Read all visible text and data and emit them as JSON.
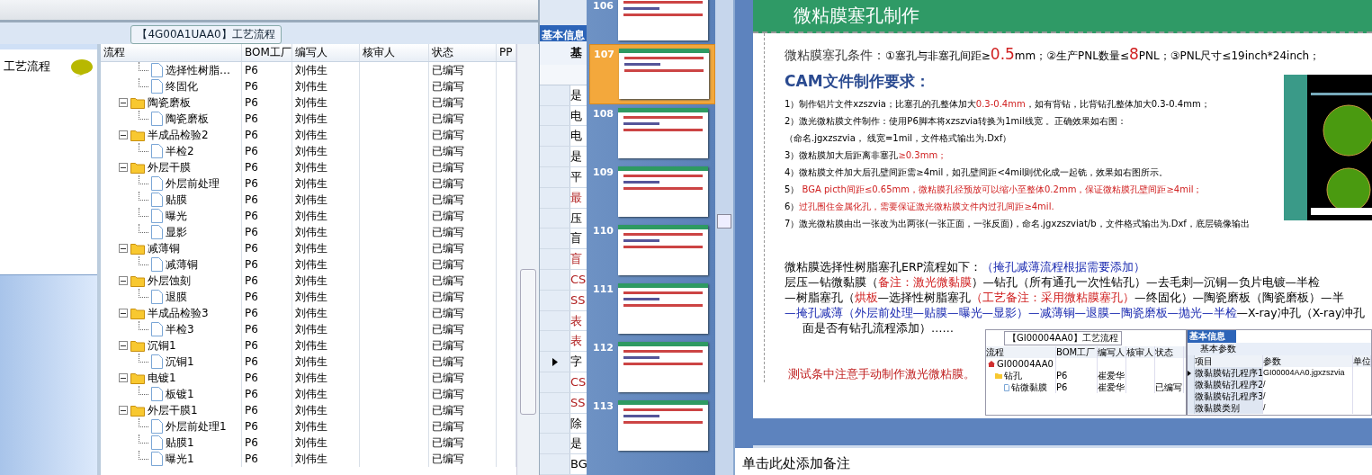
{
  "erp": {
    "title": "【4G00A1UAA0】工艺流程",
    "side_label": "工艺流程",
    "columns": [
      "流程",
      "BOM工厂",
      "编写人",
      "核审人",
      "状态",
      "PP"
    ],
    "tree": [
      {
        "kind": "continued",
        "children": [
          {
            "kind": "doc",
            "label": "选择性树脂…",
            "bom": "P6",
            "writer": "刘伟生",
            "status": "已编写"
          },
          {
            "kind": "doc",
            "label": "终固化",
            "bom": "P6",
            "writer": "刘伟生",
            "status": "已编写"
          }
        ]
      },
      {
        "kind": "folder",
        "label": "陶瓷磨板",
        "bom": "P6",
        "writer": "刘伟生",
        "status": "已编写",
        "expanded": true,
        "children": [
          {
            "kind": "doc",
            "label": "陶瓷磨板",
            "bom": "P6",
            "writer": "刘伟生",
            "status": "已编写"
          }
        ]
      },
      {
        "kind": "folder",
        "label": "半成品检验2",
        "bom": "P6",
        "writer": "刘伟生",
        "status": "已编写",
        "expanded": true,
        "children": [
          {
            "kind": "doc",
            "label": "半检2",
            "bom": "P6",
            "writer": "刘伟生",
            "status": "已编写"
          }
        ]
      },
      {
        "kind": "folder",
        "label": "外层干膜",
        "bom": "P6",
        "writer": "刘伟生",
        "status": "已编写",
        "expanded": true,
        "children": [
          {
            "kind": "doc",
            "label": "外层前处理",
            "bom": "P6",
            "writer": "刘伟生",
            "status": "已编写"
          },
          {
            "kind": "doc",
            "label": "贴膜",
            "bom": "P6",
            "writer": "刘伟生",
            "status": "已编写"
          },
          {
            "kind": "doc",
            "label": "曝光",
            "bom": "P6",
            "writer": "刘伟生",
            "status": "已编写"
          },
          {
            "kind": "doc",
            "label": "显影",
            "bom": "P6",
            "writer": "刘伟生",
            "status": "已编写"
          }
        ]
      },
      {
        "kind": "folder",
        "label": "减薄铜",
        "bom": "P6",
        "writer": "刘伟生",
        "status": "已编写",
        "expanded": true,
        "children": [
          {
            "kind": "doc",
            "label": "减薄铜",
            "bom": "P6",
            "writer": "刘伟生",
            "status": "已编写"
          }
        ]
      },
      {
        "kind": "folder",
        "label": "外层蚀刻",
        "bom": "P6",
        "writer": "刘伟生",
        "status": "已编写",
        "expanded": true,
        "children": [
          {
            "kind": "doc",
            "label": "退膜",
            "bom": "P6",
            "writer": "刘伟生",
            "status": "已编写"
          }
        ]
      },
      {
        "kind": "folder",
        "label": "半成品检验3",
        "bom": "P6",
        "writer": "刘伟生",
        "status": "已编写",
        "expanded": true,
        "children": [
          {
            "kind": "doc",
            "label": "半检3",
            "bom": "P6",
            "writer": "刘伟生",
            "status": "已编写"
          }
        ]
      },
      {
        "kind": "folder",
        "label": "沉铜1",
        "bom": "P6",
        "writer": "刘伟生",
        "status": "已编写",
        "expanded": true,
        "children": [
          {
            "kind": "doc",
            "label": "沉铜1",
            "bom": "P6",
            "writer": "刘伟生",
            "status": "已编写"
          }
        ]
      },
      {
        "kind": "folder",
        "label": "电镀1",
        "bom": "P6",
        "writer": "刘伟生",
        "status": "已编写",
        "expanded": true,
        "children": [
          {
            "kind": "doc",
            "label": "板镀1",
            "bom": "P6",
            "writer": "刘伟生",
            "status": "已编写"
          }
        ]
      },
      {
        "kind": "folder",
        "label": "外层干膜1",
        "bom": "P6",
        "writer": "刘伟生",
        "status": "已编写",
        "expanded": true,
        "children": [
          {
            "kind": "doc",
            "label": "外层前处理1",
            "bom": "P6",
            "writer": "刘伟生",
            "status": "已编写"
          },
          {
            "kind": "doc",
            "label": "贴膜1",
            "bom": "P6",
            "writer": "刘伟生",
            "status": "已编写"
          },
          {
            "kind": "doc",
            "label": "曝光1",
            "bom": "P6",
            "writer": "刘伟生",
            "status": "已编写"
          }
        ]
      }
    ]
  },
  "info": {
    "tab": "基本信息",
    "subtab": "基",
    "rows": [
      {
        "text": "是",
        "alert": false,
        "current": false
      },
      {
        "text": "电",
        "alert": false,
        "current": false
      },
      {
        "text": "电",
        "alert": false,
        "current": false
      },
      {
        "text": "是",
        "alert": false,
        "current": false
      },
      {
        "text": "平",
        "alert": false,
        "current": false
      },
      {
        "text": "最",
        "alert": true,
        "current": false
      },
      {
        "text": "压",
        "alert": false,
        "current": false
      },
      {
        "text": "盲",
        "alert": false,
        "current": false
      },
      {
        "text": "盲",
        "alert": true,
        "current": false
      },
      {
        "text": "CS",
        "alert": true,
        "current": false
      },
      {
        "text": "SS",
        "alert": true,
        "current": false
      },
      {
        "text": "表",
        "alert": true,
        "current": false
      },
      {
        "text": "表",
        "alert": true,
        "current": false
      },
      {
        "text": "字",
        "alert": false,
        "current": true
      },
      {
        "text": "CS",
        "alert": true,
        "current": false
      },
      {
        "text": "SS",
        "alert": true,
        "current": false
      },
      {
        "text": "除",
        "alert": false,
        "current": false
      },
      {
        "text": "是",
        "alert": false,
        "current": false
      },
      {
        "text": "BG",
        "alert": false,
        "current": false
      }
    ]
  },
  "slides": [
    {
      "number": "106",
      "selected": false
    },
    {
      "number": "107",
      "selected": true
    },
    {
      "number": "108",
      "selected": false
    },
    {
      "number": "109",
      "selected": false
    },
    {
      "number": "110",
      "selected": false
    },
    {
      "number": "111",
      "selected": false
    },
    {
      "number": "112",
      "selected": false
    },
    {
      "number": "113",
      "selected": false
    }
  ],
  "slide": {
    "title": "微粘膜塞孔制作",
    "conditions": [
      {
        "text": "微粘膜塞孔条件：",
        "kind": "lead"
      },
      {
        "text": "①塞孔与非塞孔间距≥",
        "kind": "plain"
      },
      {
        "text": "0.5",
        "kind": "alert"
      },
      {
        "text": "mm；②生产PNL数量≤",
        "kind": "plain"
      },
      {
        "text": "8",
        "kind": "alert"
      },
      {
        "text": "PNL；③PNL尺寸≤19inch*24inch；",
        "kind": "plain"
      }
    ],
    "heading": "CAM文件制作要求：",
    "steps": [
      [
        {
          "text": "1）制作铝片文件xzszvia；比塞孔的孔整体加大",
          "kind": "plain"
        },
        {
          "text": "0.3-0.4mm",
          "kind": "alert"
        },
        {
          "text": "，如有背钻，比背钻孔整体加大0.3-0.4mm；",
          "kind": "plain"
        }
      ],
      [
        {
          "text": "2）激光微粘膜文件制作：使用P6脚本将xzszvia转换为1mil线宽 。正确效果如右图：",
          "kind": "plain"
        }
      ],
      [
        {
          "text": "（命名.jgxzszvia， 线宽=1mil，文件格式输出为.Dxf）",
          "kind": "plain"
        }
      ],
      [
        {
          "text": "3）微粘膜加大后距离非塞孔",
          "kind": "plain"
        },
        {
          "text": "≥0.3mm；",
          "kind": "alert"
        }
      ],
      [
        {
          "text": "4）微粘膜文件加大后孔壁间距需≥4mil，如孔壁间距<4mil则优化成一起铣，效果如右图所示。",
          "kind": "plain"
        }
      ],
      [
        {
          "text": "5） ",
          "kind": "plain"
        },
        {
          "text": "BGA picth间距≤0.65mm，微粘膜孔径预放可以缩小至整体0.2mm，保证微粘膜孔壁间距≥4mil；",
          "kind": "alert"
        }
      ],
      [
        {
          "text": "6）",
          "kind": "plain"
        },
        {
          "text": "过孔围住金属化孔，需要保证激光微粘膜文件内过孔间距≥4mil.",
          "kind": "alert"
        }
      ],
      [
        {
          "text": "7）激光微粘膜由出一张改为出两张(一张正面，一张反面)，命名.jgxzszviat/b，文件格式输出为.Dxf，底层镜像输出",
          "kind": "plain"
        }
      ]
    ],
    "flow_lines": [
      [
        {
          "text": "微粘膜选择性树脂塞孔ERP流程如下：",
          "kind": "plain"
        },
        {
          "text": "（掩孔减薄流程根据需要添加）",
          "kind": "optional"
        }
      ],
      [
        {
          "text": "层压—钻微黏膜（",
          "kind": "plain"
        },
        {
          "text": "备注：激光微黏膜",
          "kind": "alert"
        },
        {
          "text": "）—钻孔（所有通孔一次性钻孔）—去毛刺—沉铜—负片电镀—半检",
          "kind": "plain"
        }
      ],
      [
        {
          "text": "—树脂塞孔（",
          "kind": "plain"
        },
        {
          "text": "烘板",
          "kind": "alert"
        },
        {
          "text": "—选择性树脂塞孔",
          "kind": "plain"
        },
        {
          "text": "（工艺备注：采用微粘膜塞孔）",
          "kind": "alert"
        },
        {
          "text": "—终固化）—陶瓷磨板（陶瓷磨板）—半",
          "kind": "plain"
        }
      ],
      [
        {
          "text": "—掩孔减薄（外层前处理—贴膜—曝光—显影）—减薄铜—退膜—陶瓷磨板—抛光—半检",
          "kind": "optional"
        },
        {
          "text": "—X-ray冲孔（X-ray冲孔",
          "kind": "plain"
        }
      ],
      [
        {
          "text": "面是否有钻孔流程添加）……",
          "kind": "plain"
        }
      ]
    ],
    "warning": "测试条中注意手动制作激光微粘膜。",
    "embedded": {
      "title": "【GI00004AA0】工艺流程",
      "columns": [
        "流程",
        "BOM工厂",
        "编写人",
        "核审人",
        "状态"
      ],
      "rows": [
        {
          "kind": "root",
          "label": "GI00004AA0"
        },
        {
          "kind": "folder",
          "label": "钻孔",
          "bom": "P6",
          "writer": "崔爱华"
        },
        {
          "kind": "doc",
          "label": "钻微黏膜",
          "bom": "P6",
          "writer": "崔爱华",
          "status": "已编写"
        }
      ],
      "tab": "基本信息",
      "subtab": "基本参数",
      "param_columns": [
        "项目",
        "参数",
        "单位"
      ],
      "params": [
        {
          "item": "微黏膜钻孔程序1",
          "value": "GI00004AA0.jgxzszvia",
          "current": true
        },
        {
          "item": "微黏膜钻孔程序2",
          "value": "/",
          "current": false
        },
        {
          "item": "微黏膜钻孔程序3",
          "value": "/",
          "current": false
        },
        {
          "item": "微黏膜类别",
          "value": "/",
          "current": false
        }
      ]
    }
  },
  "notes_placeholder": "单击此处添加备注"
}
